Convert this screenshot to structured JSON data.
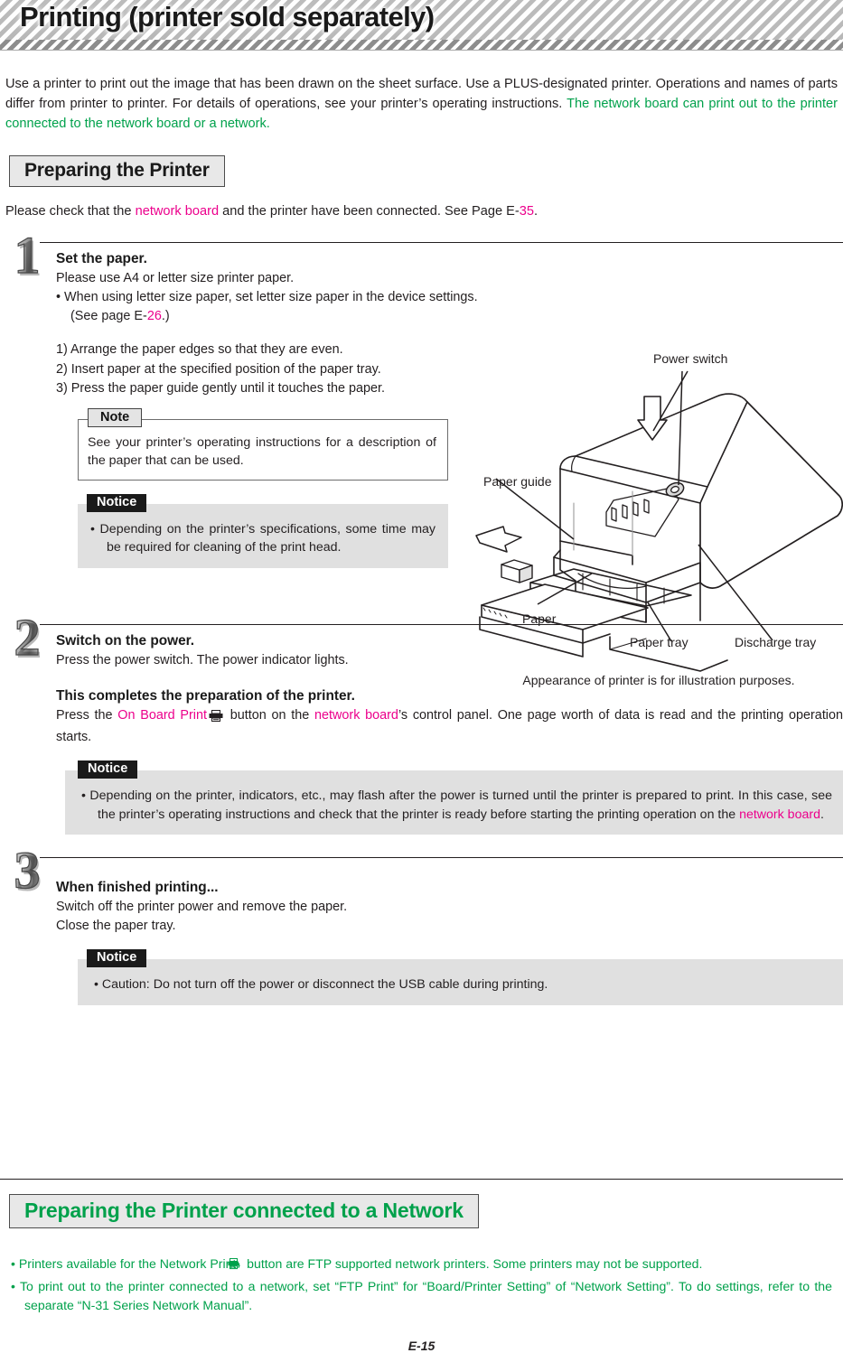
{
  "header": {
    "title": "Printing (printer sold separately)"
  },
  "intro": {
    "black_part": "Use a printer to print out the image that has been drawn on the sheet surface. Use a PLUS-designated printer. Operations and names of parts differ from printer to printer. For details of operations, see your printer’s operating instructions. ",
    "green_part": "The network board can print out to the printer connected to the network board or a network."
  },
  "section1": {
    "title": "Preparing the Printer",
    "lead_a": "Please check that the ",
    "lead_link": "network board",
    "lead_b": " and the printer have been connected. See Page E-",
    "lead_page": "35",
    "lead_c": "."
  },
  "steps": [
    {
      "number": "1",
      "title": "Set the paper.",
      "line1": "Please use A4 or letter size printer paper.",
      "bullet_a": "•  When using letter size paper, set letter size paper in the device settings. (See page E-",
      "bullet_page": "26",
      "bullet_b": ".)",
      "numbered": [
        "1) Arrange the paper edges so that they are even.",
        "2) Insert paper at the specified position of the paper tray.",
        "3) Press the paper guide gently until it touches the paper."
      ],
      "note": {
        "tab": "Note",
        "text": "See your printer’s operating instructions for a description of the paper that can be used."
      },
      "notice": {
        "tab": "Notice",
        "text": "•  Depending on the printer’s specifications, some time may be required for cleaning of the print head."
      }
    },
    {
      "number": "2",
      "title": "Switch on the power.",
      "line1": "Press the power switch. The power indicator lights.",
      "subtitle": "This completes the preparation of the printer.",
      "body_a": "Press the ",
      "body_link1": "On Board Print",
      "body_icon": "printer-icon",
      "body_b": " button on the ",
      "body_link2": "network board",
      "body_c": "’s control panel. One page worth of data is read and the printing operation starts.",
      "notice": {
        "tab": "Notice",
        "text_a": "•  Depending on the printer, indicators, etc., may flash after the power is turned until the printer is prepared to print. In this case, see the printer’s operating instructions and check that the printer is ready before starting the printing operation on the ",
        "text_link": "network board",
        "text_b": "."
      }
    },
    {
      "number": "3",
      "title": "When finished printing...",
      "line1": "Switch off the printer power and remove the paper.",
      "line2": "Close the paper tray.",
      "notice": {
        "tab": "Notice",
        "text": "•  Caution: Do not turn off the power or disconnect the USB cable during printing."
      }
    }
  ],
  "illustration": {
    "label_power_switch": "Power switch",
    "label_paper_guide": "Paper guide",
    "label_paper": "Paper",
    "label_paper_tray": "Paper tray",
    "label_discharge_tray": "Discharge tray",
    "caption": "Appearance of printer is for illustration purposes."
  },
  "section2": {
    "title": "Preparing the Printer connected to a Network",
    "bullet1_a": "•  Printers available for the Network Print ",
    "bullet1_icon": "network-print-icon",
    "bullet1_b": " button are FTP supported network printers. Some printers may not be supported.",
    "bullet2": "•  To print out to the printer connected to a network, set “FTP Print” for “Board/Printer Setting” of “Network Setting”. To do settings, refer to the separate “N-31 Series Network Manual”."
  },
  "footer": {
    "page": "E-15"
  },
  "colors": {
    "green": "#00a14b",
    "magenta": "#ec008c",
    "ink": "#231f20",
    "notice_bg": "#e0e0e0"
  }
}
